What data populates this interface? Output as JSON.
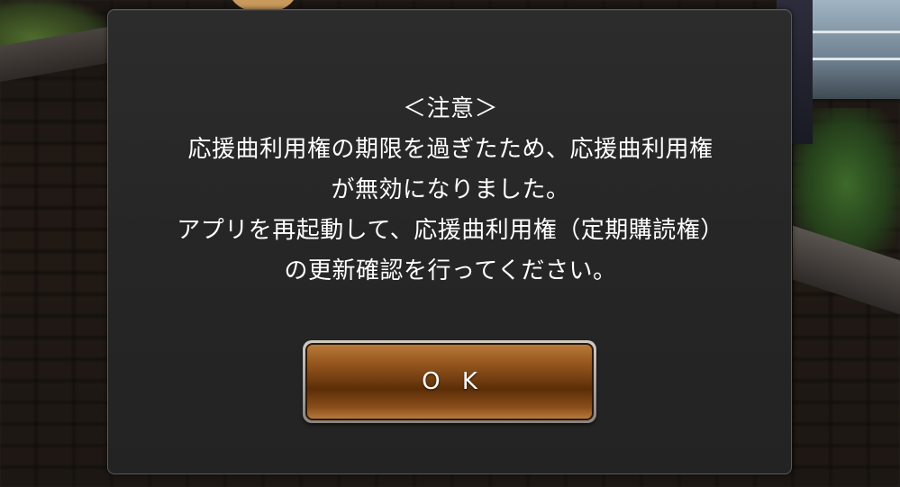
{
  "dialog": {
    "lines": [
      "＜注意＞",
      "応援曲利用権の期限を過ぎたため、応援曲利用権",
      "が無効になりました。",
      "アプリを再起動して、応援曲利用権（定期購読権）",
      "の更新確認を行ってください。"
    ],
    "ok_label": "O K"
  },
  "colors": {
    "dialog_bg": "#262626",
    "button_brown": "#6e3a0e",
    "text": "#ffffff"
  }
}
